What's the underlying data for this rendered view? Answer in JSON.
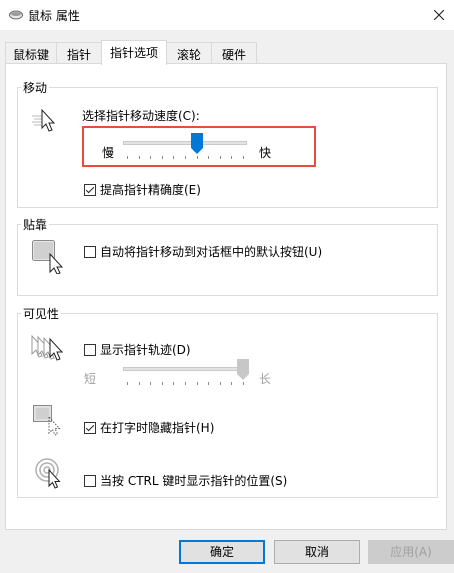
{
  "window": {
    "title": "鼠标 属性",
    "close_label": "关闭"
  },
  "tabs": [
    {
      "label": "鼠标键",
      "active": false
    },
    {
      "label": "指针",
      "active": false
    },
    {
      "label": "指针选项",
      "active": true
    },
    {
      "label": "滚轮",
      "active": false
    },
    {
      "label": "硬件",
      "active": false
    }
  ],
  "motion": {
    "group_label": "移动",
    "speed_label": "选择指针移动速度(C):",
    "slow_label": "慢",
    "fast_label": "快",
    "speed_value": 6,
    "speed_max": 10,
    "precision_label": "提高指针精确度(E)",
    "precision_checked": true
  },
  "snap": {
    "group_label": "贴靠",
    "snap_label": "自动将指针移动到对话框中的默认按钮(U)",
    "snap_checked": false
  },
  "visibility": {
    "group_label": "可见性",
    "trails_label": "显示指针轨迹(D)",
    "trails_checked": false,
    "short_label": "短",
    "long_label": "长",
    "trails_value": 10,
    "trails_max": 10,
    "hide_label": "在打字时隐藏指针(H)",
    "hide_checked": true,
    "ctrl_label": "当按 CTRL 键时显示指针的位置(S)",
    "ctrl_checked": false
  },
  "buttons": {
    "ok": "确定",
    "cancel": "取消",
    "apply": "应用(A)"
  },
  "colors": {
    "accent": "#0078d7",
    "highlight": "#e94b3c"
  }
}
